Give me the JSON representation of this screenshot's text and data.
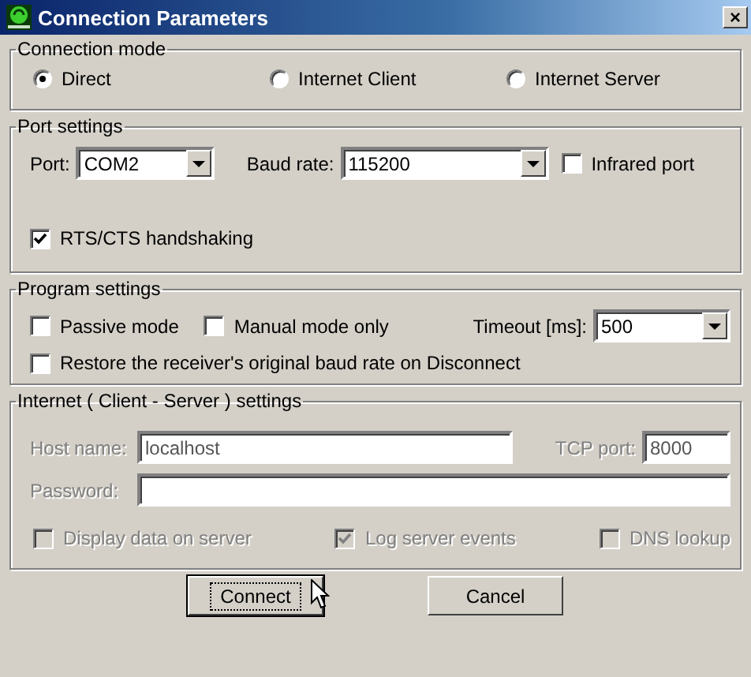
{
  "window": {
    "title": "Connection Parameters",
    "close": "×"
  },
  "connection_mode": {
    "title": "Connection mode",
    "options": [
      {
        "label": "Direct",
        "selected": true
      },
      {
        "label": "Internet Client",
        "selected": false
      },
      {
        "label": "Internet Server",
        "selected": false
      }
    ]
  },
  "port_settings": {
    "title": "Port settings",
    "port_label": "Port:",
    "port": "COM2",
    "baud_label": "Baud rate:",
    "baud": "115200",
    "infrared": {
      "label": "Infrared port",
      "checked": false
    },
    "rts_cts": {
      "label": "RTS/CTS handshaking",
      "checked": true
    }
  },
  "program_settings": {
    "title": "Program settings",
    "passive": {
      "label": "Passive mode",
      "checked": false
    },
    "manual": {
      "label": "Manual mode only",
      "checked": false
    },
    "timeout_label": "Timeout [ms]:",
    "timeout": "500",
    "restore": {
      "label": "Restore the receiver's original baud rate on Disconnect",
      "checked": false
    }
  },
  "internet": {
    "title": "Internet ( Client - Server ) settings",
    "disabled": true,
    "host_label": "Host name:",
    "host": "localhost",
    "tcp_label": "TCP port:",
    "tcp": "8000",
    "password_label": "Password:",
    "options": [
      {
        "label": "Display data on server",
        "checked": false
      },
      {
        "label": "Log server events",
        "checked": true
      },
      {
        "label": "DNS lookup",
        "checked": false
      }
    ]
  },
  "buttons": [
    {
      "label": "Connect",
      "focused": true
    },
    {
      "label": "Cancel",
      "focused": false
    }
  ]
}
